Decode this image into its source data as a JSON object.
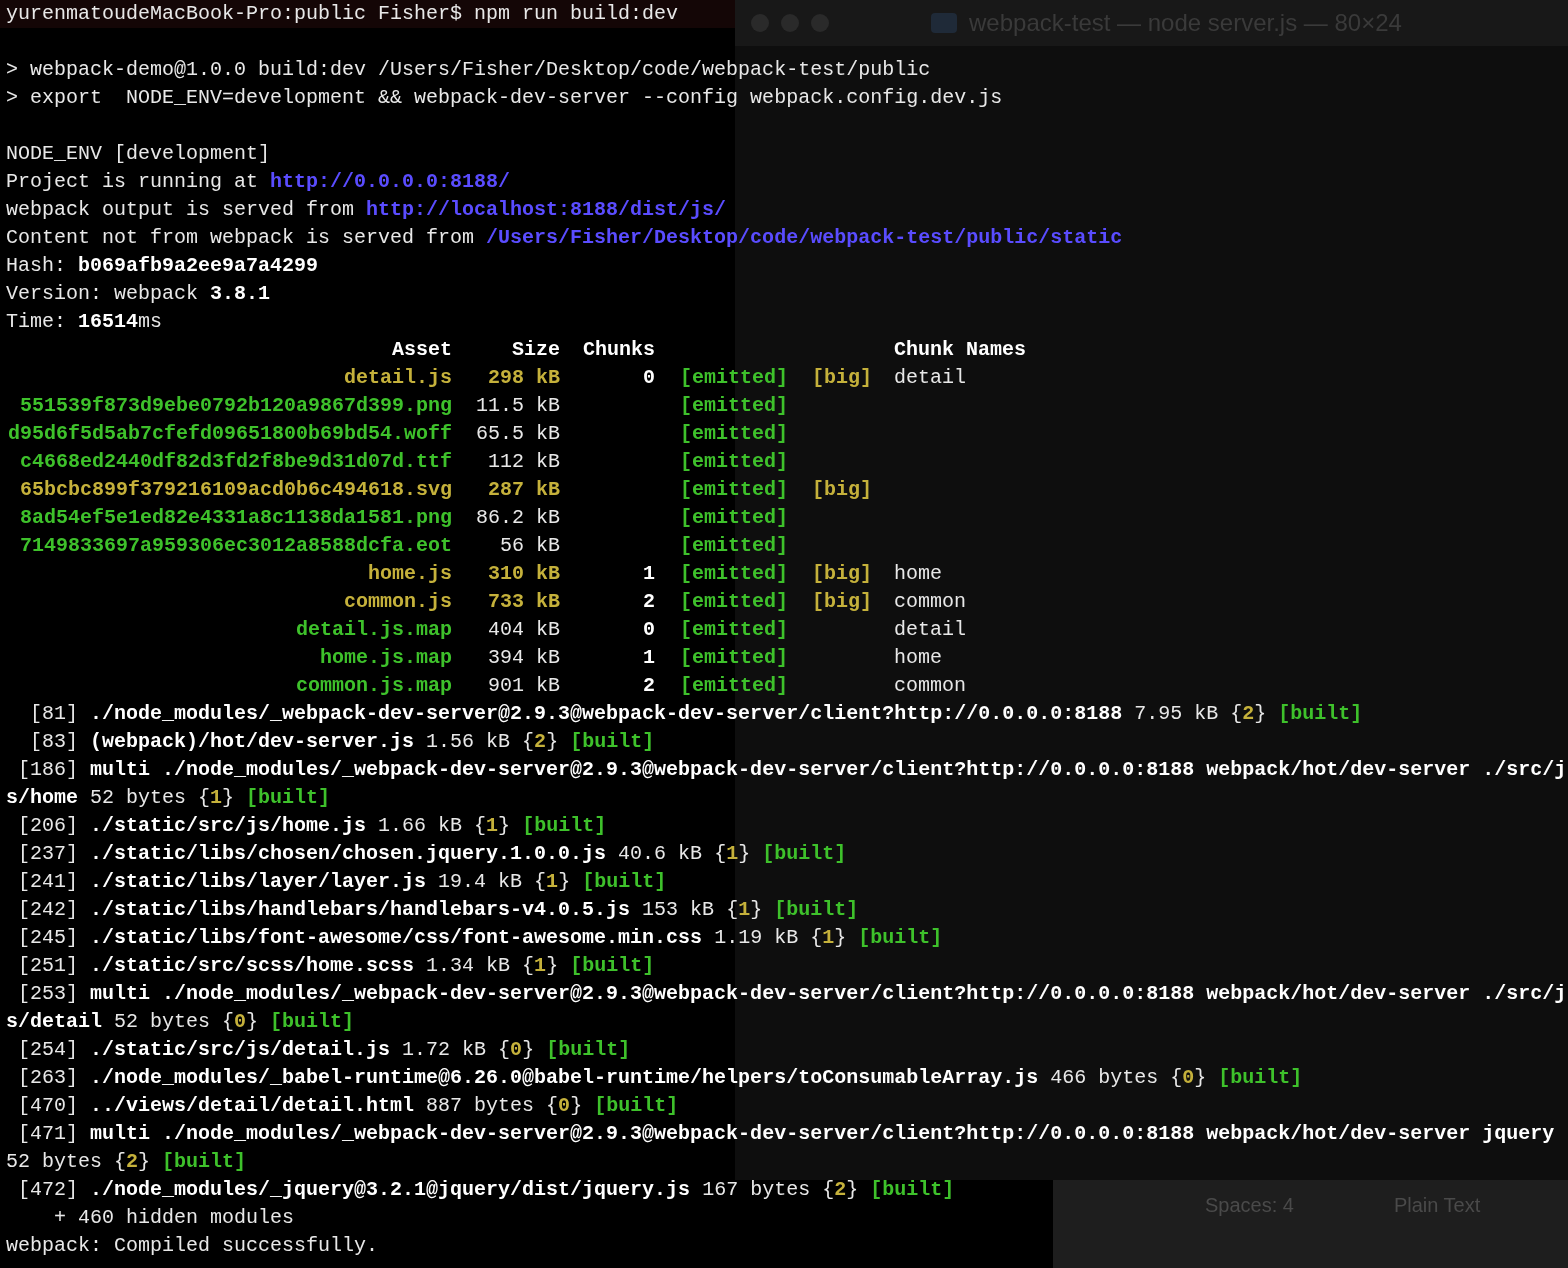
{
  "background_window": {
    "title": "webpack-test — node server.js — 80×24"
  },
  "editor_status_bar": {
    "items": [
      "Spaces: 4",
      "Plain Text"
    ]
  },
  "terminal": {
    "lines": [
      {
        "kind": "prompt",
        "segments": [
          {
            "text": "yurenmatoudeMacBook-Pro:public Fisher$ npm run build:dev",
            "kind": "plain"
          }
        ]
      },
      {
        "kind": "blank"
      },
      {
        "kind": "text",
        "segments": [
          {
            "text": "> webpack-demo@1.0.0 build:dev /Users/Fisher/Desktop/code/webpack-test/public",
            "kind": "plain"
          }
        ]
      },
      {
        "kind": "text",
        "segments": [
          {
            "text": "> export  NODE_ENV=development && webpack-dev-server --config webpack.config.dev.js",
            "kind": "plain"
          }
        ]
      },
      {
        "kind": "blank"
      },
      {
        "kind": "text",
        "segments": [
          {
            "text": "NODE_ENV [development]",
            "kind": "plain"
          }
        ]
      },
      {
        "kind": "text",
        "segments": [
          {
            "text": "Project is running at ",
            "kind": "plain"
          },
          {
            "text": "http://0.0.0.0:8188/",
            "kind": "link"
          }
        ]
      },
      {
        "kind": "text",
        "segments": [
          {
            "text": "webpack output is served from ",
            "kind": "plain"
          },
          {
            "text": "http://localhost:8188/dist/js/",
            "kind": "link"
          }
        ]
      },
      {
        "kind": "text",
        "segments": [
          {
            "text": "Content not from webpack is served from ",
            "kind": "plain"
          },
          {
            "text": "/Users/Fisher/Desktop/code/webpack-test/public/static",
            "kind": "link"
          }
        ]
      },
      {
        "kind": "text",
        "segments": [
          {
            "text": "Hash: ",
            "kind": "plain"
          },
          {
            "text": "b069afb9a2ee9a7a4299",
            "kind": "bold"
          }
        ]
      },
      {
        "kind": "text",
        "segments": [
          {
            "text": "Version: webpack ",
            "kind": "plain"
          },
          {
            "text": "3.8.1",
            "kind": "bold"
          }
        ]
      },
      {
        "kind": "text",
        "segments": [
          {
            "text": "Time: ",
            "kind": "plain"
          },
          {
            "text": "16514",
            "kind": "bold"
          },
          {
            "text": "ms",
            "kind": "plain"
          }
        ]
      },
      {
        "kind": "asset_header",
        "asset": "Asset",
        "size": "Size",
        "chunks": "Chunks",
        "chunk_names": "Chunk Names"
      },
      {
        "kind": "asset",
        "oversized": true,
        "asset": "detail.js",
        "size": "298 kB",
        "chunks": "0",
        "emitted": "[emitted]",
        "big": "[big]",
        "chunk_names": "detail"
      },
      {
        "kind": "asset",
        "oversized": false,
        "asset": "551539f873d9ebe0792b120a9867d399.png",
        "size": "11.5 kB",
        "emitted": "[emitted]"
      },
      {
        "kind": "asset",
        "oversized": false,
        "asset": "d95d6f5d5ab7cfefd09651800b69bd54.woff",
        "size": "65.5 kB",
        "emitted": "[emitted]"
      },
      {
        "kind": "asset",
        "oversized": false,
        "asset": "c4668ed2440df82d3fd2f8be9d31d07d.ttf",
        "size": "112 kB",
        "emitted": "[emitted]"
      },
      {
        "kind": "asset",
        "oversized": true,
        "asset": "65bcbc899f379216109acd0b6c494618.svg",
        "size": "287 kB",
        "emitted": "[emitted]",
        "big": "[big]"
      },
      {
        "kind": "asset",
        "oversized": false,
        "asset": "8ad54ef5e1ed82e4331a8c1138da1581.png",
        "size": "86.2 kB",
        "emitted": "[emitted]"
      },
      {
        "kind": "asset",
        "oversized": false,
        "asset": "7149833697a959306ec3012a8588dcfa.eot",
        "size": "56 kB",
        "emitted": "[emitted]"
      },
      {
        "kind": "asset",
        "oversized": true,
        "asset": "home.js",
        "size": "310 kB",
        "chunks": "1",
        "emitted": "[emitted]",
        "big": "[big]",
        "chunk_names": "home"
      },
      {
        "kind": "asset",
        "oversized": true,
        "asset": "common.js",
        "size": "733 kB",
        "chunks": "2",
        "emitted": "[emitted]",
        "big": "[big]",
        "chunk_names": "common"
      },
      {
        "kind": "asset",
        "oversized": false,
        "asset": "detail.js.map",
        "size": "404 kB",
        "chunks": "0",
        "emitted": "[emitted]",
        "chunk_names": "detail"
      },
      {
        "kind": "asset",
        "oversized": false,
        "asset": "home.js.map",
        "size": "394 kB",
        "chunks": "1",
        "emitted": "[emitted]",
        "chunk_names": "home"
      },
      {
        "kind": "asset",
        "oversized": false,
        "asset": "common.js.map",
        "size": "901 kB",
        "chunks": "2",
        "emitted": "[emitted]",
        "chunk_names": "common"
      },
      {
        "kind": "text",
        "segments": [
          {
            "text": "  [81] ",
            "kind": "plain"
          },
          {
            "text": "./node_modules/_webpack-dev-server@2.9.3@webpack-dev-server/client?http://0.0.0.0:8188",
            "kind": "bold"
          },
          {
            "text": " 7.95 kB {",
            "kind": "plain"
          },
          {
            "text": "2",
            "kind": "chunk"
          },
          {
            "text": "} ",
            "kind": "plain"
          },
          {
            "text": "[built]",
            "kind": "tag"
          }
        ]
      },
      {
        "kind": "text",
        "segments": [
          {
            "text": "  [83] ",
            "kind": "plain"
          },
          {
            "text": "(webpack)/hot/dev-server.js",
            "kind": "bold"
          },
          {
            "text": " 1.56 kB {",
            "kind": "plain"
          },
          {
            "text": "2",
            "kind": "chunk"
          },
          {
            "text": "} ",
            "kind": "plain"
          },
          {
            "text": "[built]",
            "kind": "tag"
          }
        ]
      },
      {
        "kind": "text",
        "segments": [
          {
            "text": " [186] ",
            "kind": "plain"
          },
          {
            "text": "multi ./node_modules/_webpack-dev-server@2.9.3@webpack-dev-server/client?http://0.0.0.0:8188 webpack/hot/dev-server ./src/j",
            "kind": "bold"
          }
        ]
      },
      {
        "kind": "text",
        "segments": [
          {
            "text": "s/home",
            "kind": "bold"
          },
          {
            "text": " 52 bytes {",
            "kind": "plain"
          },
          {
            "text": "1",
            "kind": "chunk"
          },
          {
            "text": "} ",
            "kind": "plain"
          },
          {
            "text": "[built]",
            "kind": "tag"
          }
        ]
      },
      {
        "kind": "text",
        "segments": [
          {
            "text": " [206] ",
            "kind": "plain"
          },
          {
            "text": "./static/src/js/home.js",
            "kind": "bold"
          },
          {
            "text": " 1.66 kB {",
            "kind": "plain"
          },
          {
            "text": "1",
            "kind": "chunk"
          },
          {
            "text": "} ",
            "kind": "plain"
          },
          {
            "text": "[built]",
            "kind": "tag"
          }
        ]
      },
      {
        "kind": "text",
        "segments": [
          {
            "text": " [237] ",
            "kind": "plain"
          },
          {
            "text": "./static/libs/chosen/chosen.jquery.1.0.0.js",
            "kind": "bold"
          },
          {
            "text": " 40.6 kB {",
            "kind": "plain"
          },
          {
            "text": "1",
            "kind": "chunk"
          },
          {
            "text": "} ",
            "kind": "plain"
          },
          {
            "text": "[built]",
            "kind": "tag"
          }
        ]
      },
      {
        "kind": "text",
        "segments": [
          {
            "text": " [241] ",
            "kind": "plain"
          },
          {
            "text": "./static/libs/layer/layer.js",
            "kind": "bold"
          },
          {
            "text": " 19.4 kB {",
            "kind": "plain"
          },
          {
            "text": "1",
            "kind": "chunk"
          },
          {
            "text": "} ",
            "kind": "plain"
          },
          {
            "text": "[built]",
            "kind": "tag"
          }
        ]
      },
      {
        "kind": "text",
        "segments": [
          {
            "text": " [242] ",
            "kind": "plain"
          },
          {
            "text": "./static/libs/handlebars/handlebars-v4.0.5.js",
            "kind": "bold"
          },
          {
            "text": " 153 kB {",
            "kind": "plain"
          },
          {
            "text": "1",
            "kind": "chunk"
          },
          {
            "text": "} ",
            "kind": "plain"
          },
          {
            "text": "[built]",
            "kind": "tag"
          }
        ]
      },
      {
        "kind": "text",
        "segments": [
          {
            "text": " [245] ",
            "kind": "plain"
          },
          {
            "text": "./static/libs/font-awesome/css/font-awesome.min.css",
            "kind": "bold"
          },
          {
            "text": " 1.19 kB {",
            "kind": "plain"
          },
          {
            "text": "1",
            "kind": "chunk"
          },
          {
            "text": "} ",
            "kind": "plain"
          },
          {
            "text": "[built]",
            "kind": "tag"
          }
        ]
      },
      {
        "kind": "text",
        "segments": [
          {
            "text": " [251] ",
            "kind": "plain"
          },
          {
            "text": "./static/src/scss/home.scss",
            "kind": "bold"
          },
          {
            "text": " 1.34 kB {",
            "kind": "plain"
          },
          {
            "text": "1",
            "kind": "chunk"
          },
          {
            "text": "} ",
            "kind": "plain"
          },
          {
            "text": "[built]",
            "kind": "tag"
          }
        ]
      },
      {
        "kind": "text",
        "segments": [
          {
            "text": " [253] ",
            "kind": "plain"
          },
          {
            "text": "multi ./node_modules/_webpack-dev-server@2.9.3@webpack-dev-server/client?http://0.0.0.0:8188 webpack/hot/dev-server ./src/j",
            "kind": "bold"
          }
        ]
      },
      {
        "kind": "text",
        "segments": [
          {
            "text": "s/detail",
            "kind": "bold"
          },
          {
            "text": " 52 bytes {",
            "kind": "plain"
          },
          {
            "text": "0",
            "kind": "chunk"
          },
          {
            "text": "} ",
            "kind": "plain"
          },
          {
            "text": "[built]",
            "kind": "tag"
          }
        ]
      },
      {
        "kind": "text",
        "segments": [
          {
            "text": " [254] ",
            "kind": "plain"
          },
          {
            "text": "./static/src/js/detail.js",
            "kind": "bold"
          },
          {
            "text": " 1.72 kB {",
            "kind": "plain"
          },
          {
            "text": "0",
            "kind": "chunk"
          },
          {
            "text": "} ",
            "kind": "plain"
          },
          {
            "text": "[built]",
            "kind": "tag"
          }
        ]
      },
      {
        "kind": "text",
        "segments": [
          {
            "text": " [263] ",
            "kind": "plain"
          },
          {
            "text": "./node_modules/_babel-runtime@6.26.0@babel-runtime/helpers/toConsumableArray.js",
            "kind": "bold"
          },
          {
            "text": " 466 bytes {",
            "kind": "plain"
          },
          {
            "text": "0",
            "kind": "chunk"
          },
          {
            "text": "} ",
            "kind": "plain"
          },
          {
            "text": "[built]",
            "kind": "tag"
          }
        ]
      },
      {
        "kind": "text",
        "segments": [
          {
            "text": " [470] ",
            "kind": "plain"
          },
          {
            "text": "../views/detail/detail.html",
            "kind": "bold"
          },
          {
            "text": " 887 bytes {",
            "kind": "plain"
          },
          {
            "text": "0",
            "kind": "chunk"
          },
          {
            "text": "} ",
            "kind": "plain"
          },
          {
            "text": "[built]",
            "kind": "tag"
          }
        ]
      },
      {
        "kind": "text",
        "segments": [
          {
            "text": " [471] ",
            "kind": "plain"
          },
          {
            "text": "multi ./node_modules/_webpack-dev-server@2.9.3@webpack-dev-server/client?http://0.0.0.0:8188 webpack/hot/dev-server jquery",
            "kind": "bold"
          }
        ]
      },
      {
        "kind": "text",
        "segments": [
          {
            "text": "52 bytes {",
            "kind": "plain"
          },
          {
            "text": "2",
            "kind": "chunk"
          },
          {
            "text": "} ",
            "kind": "plain"
          },
          {
            "text": "[built]",
            "kind": "tag"
          }
        ]
      },
      {
        "kind": "text",
        "segments": [
          {
            "text": " [472] ",
            "kind": "plain"
          },
          {
            "text": "./node_modules/_jquery@3.2.1@jquery/dist/jquery.js",
            "kind": "bold"
          },
          {
            "text": " 167 bytes {",
            "kind": "plain"
          },
          {
            "text": "2",
            "kind": "chunk"
          },
          {
            "text": "} ",
            "kind": "plain"
          },
          {
            "text": "[built]",
            "kind": "tag"
          }
        ]
      },
      {
        "kind": "text",
        "segments": [
          {
            "text": "    + 460 hidden modules",
            "kind": "plain"
          }
        ]
      },
      {
        "kind": "text",
        "segments": [
          {
            "text": "webpack: Compiled successfully.",
            "kind": "plain"
          }
        ]
      }
    ]
  }
}
